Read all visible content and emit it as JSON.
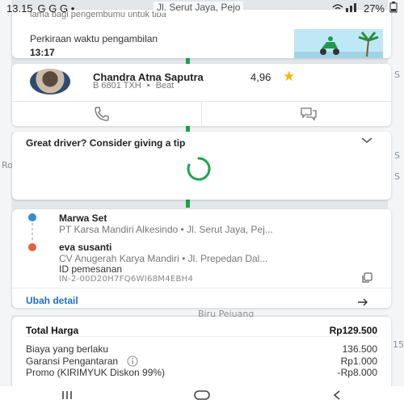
{
  "status_bar": {
    "time": "13.15",
    "notifications": "G G G •",
    "location_snippet": "Jl. Serut Jaya, Pejo",
    "battery": "27%"
  },
  "map": {
    "labels": [
      "Biru Pejuang",
      "15",
      "S",
      "S",
      "S",
      "Ro"
    ]
  },
  "pickup_card": {
    "behind_text": "lama bagi pengembumu untuk tiba",
    "label": "Perkiraan waktu pengambilan",
    "time": "13:17"
  },
  "driver": {
    "name": "Chandra Atna Saputra",
    "rating": "4,96",
    "plate": "B 6801 TXH",
    "separator": "•",
    "vehicle": "Beat"
  },
  "tip_card": {
    "question": "Great driver? Consider giving a tip"
  },
  "route": {
    "pickup_name": "Marwa Set",
    "pickup_address": "PT Karsa Mandiri Alkesindo  •  Jl. Serut Jaya, Pej...",
    "dropoff_name": "eva susanti",
    "dropoff_address": "CV Anugerah Karya Mandiri  •  Jl. Prepedan Dal...",
    "order_id_label": "ID pemesanan",
    "order_id": "IN-2-00D20H7FQ6WI68M4EBH4",
    "edit_label": "Ubah detail"
  },
  "price": {
    "total_label": "Total Harga",
    "total_value": "Rp129.500",
    "items": [
      {
        "label": "Biaya yang berlaku",
        "value": "136.500"
      },
      {
        "label": "Garansi Pengantaran",
        "value": "Rp1.000"
      },
      {
        "label": "Promo (KIRIMYUK Diskon 99%)",
        "value": "-Rp8.000"
      }
    ]
  },
  "colors": {
    "route_green": "#17a84a",
    "link_blue": "#1e6fd2",
    "pickup_dot": "#2a8fdc",
    "dropoff_dot": "#e8603c",
    "star": "#f2b705"
  },
  "icons": [
    "phone-icon",
    "chat-icon",
    "star-icon",
    "chevron-down-icon",
    "copy-icon",
    "arrow-right-icon",
    "info-icon",
    "recents-icon",
    "home-icon",
    "back-icon"
  ]
}
